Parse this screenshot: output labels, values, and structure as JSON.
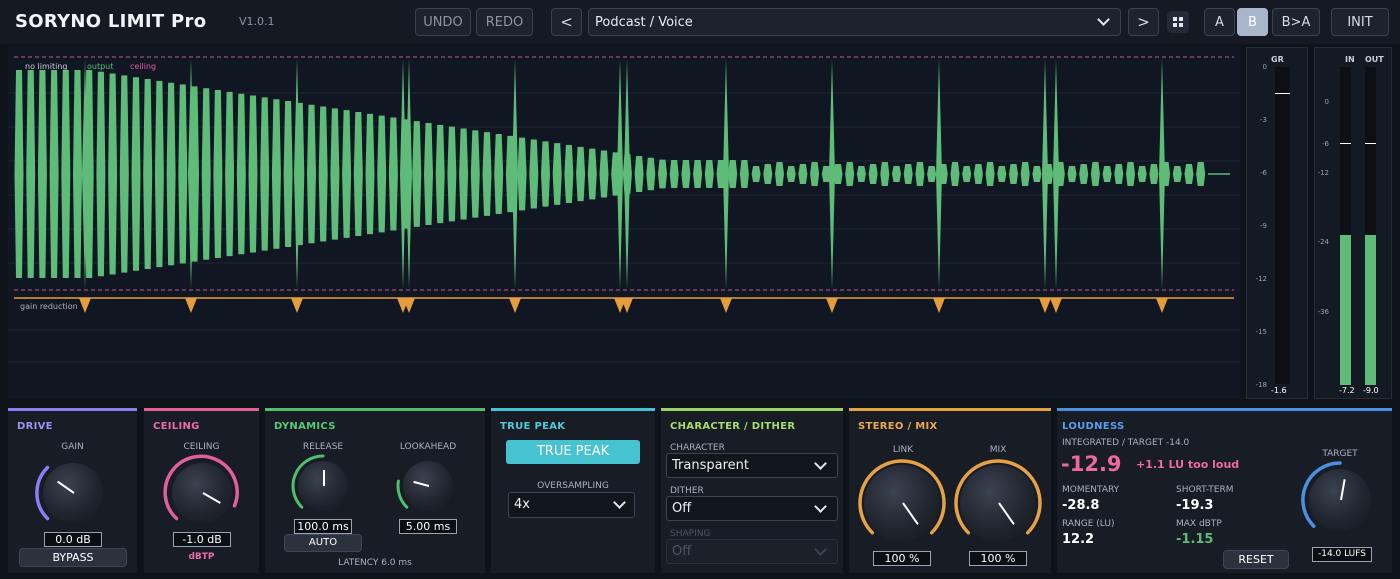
{
  "header": {
    "title": "SORYNO LIMIT Pro",
    "version": "V1.0.1",
    "undo_label": "UNDO",
    "redo_label": "REDO",
    "prev_label": "<",
    "next_label": ">",
    "preset_name": "Podcast / Voice",
    "slot_a_label": "A",
    "slot_b_label": "B",
    "copy_label": "B>A",
    "init_label": "INIT"
  },
  "waveform": {
    "legend_no_limiting": "no limiting",
    "legend_output": "output",
    "legend_ceiling": "ceiling",
    "gain_reduction_label": "gain reduction",
    "colors": {
      "output": "#5ebc78",
      "ceiling": "#e0609a",
      "gain_reduction": "#e59d3c"
    }
  },
  "gr_meter": {
    "title": "GR",
    "scale": [
      "0",
      "-3",
      "-6",
      "-9",
      "-12",
      "-15",
      "-18"
    ],
    "readout": "-1.6"
  },
  "io_meter": {
    "in_label": "IN",
    "out_label": "OUT",
    "scale": [
      "0",
      "-6",
      "-12",
      "-24",
      "-36"
    ],
    "in_readout": "-7.2",
    "out_readout": "-9.0"
  },
  "drive": {
    "title": "DRIVE",
    "gain_label": "GAIN",
    "gain_value": "0.0 dB",
    "bypass_label": "BYPASS",
    "color": "#8a7ef0"
  },
  "ceiling": {
    "title": "CEILING",
    "ceiling_label": "CEILING",
    "ceiling_value": "-1.0 dB",
    "unit_label": "dBTP",
    "color": "#e0609a"
  },
  "dynamics": {
    "title": "DYNAMICS",
    "release_label": "RELEASE",
    "release_value": "100.0 ms",
    "lookahead_label": "LOOKAHEAD",
    "lookahead_value": "5.00 ms",
    "auto_label": "AUTO",
    "latency_text": "LATENCY  6.0 ms",
    "color": "#4fbf6e"
  },
  "true_peak": {
    "title": "TRUE PEAK",
    "toggle_label": "TRUE PEAK",
    "oversampling_label": "OVERSAMPLING",
    "oversampling_value": "4x",
    "color": "#45c3d0"
  },
  "character": {
    "title": "CHARACTER / DITHER",
    "character_label": "CHARACTER",
    "character_value": "Transparent",
    "dither_label": "DITHER",
    "dither_value": "Off",
    "shaping_label": "SHAPING",
    "shaping_value": "Off",
    "color": "#9ed260"
  },
  "stereo": {
    "title": "STEREO / MIX",
    "link_label": "LINK",
    "link_value": "100 %",
    "mix_label": "MIX",
    "mix_value": "100 %",
    "color": "#e6a144"
  },
  "loudness": {
    "title": "LOUDNESS",
    "integrated_label": "INTEGRATED  /  TARGET -14.0",
    "integrated_value": "-12.9",
    "delta_text": "+1.1 LU  too loud",
    "momentary_label": "MOMENTARY",
    "momentary_value": "-28.8",
    "short_term_label": "SHORT-TERM",
    "short_term_value": "-19.3",
    "range_label": "RANGE (LU)",
    "range_value": "12.2",
    "max_label": "MAX dBTP",
    "max_value": "-1.15",
    "reset_label": "RESET",
    "target_label": "TARGET",
    "target_value": "-14.0 LUFS",
    "color": "#4a8fe0"
  }
}
